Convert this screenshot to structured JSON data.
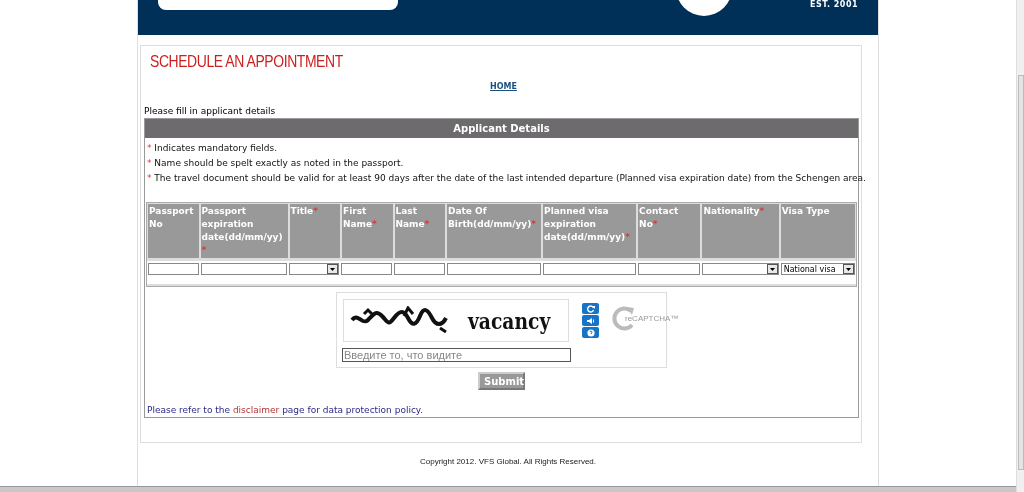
{
  "header": {
    "est": "EST. 2001"
  },
  "title": "SCHEDULE AN APPOINTMENT",
  "home_link": "HOME",
  "intro": "Please fill in applicant details",
  "section": {
    "title": "Applicant Details",
    "notes": [
      {
        "mark": "*",
        "text": "Indicates mandatory fields."
      },
      {
        "mark": "*",
        "text": "Name should be spelt exactly as noted in the passport."
      },
      {
        "mark": "*",
        "text": "The travel document should be valid for at least 90 days after the date of the last intended departure (Planned visa expiration date) from the Schengen area."
      }
    ],
    "columns": [
      {
        "label": "Passport No",
        "kind": "text"
      },
      {
        "label": "Passport expiration date(dd/mm/yy)",
        "required_mark": "*",
        "kind": "text"
      },
      {
        "label": "Title",
        "required_mark": "*",
        "kind": "select"
      },
      {
        "label": "First Name",
        "required_mark": "*",
        "kind": "text"
      },
      {
        "label": "Last Name",
        "required_mark": "*",
        "kind": "text"
      },
      {
        "label": "Date Of Birth(dd/mm/yy)",
        "required_mark": "*",
        "kind": "text"
      },
      {
        "label": "Planned visa expiration date(dd/mm/yy)",
        "required_mark": "*",
        "kind": "text"
      },
      {
        "label": "Contact No",
        "required_mark": "*",
        "kind": "text"
      },
      {
        "label": "Nationality",
        "required_mark": "*",
        "kind": "select"
      },
      {
        "label": "Visa Type",
        "kind": "select",
        "value": "National visa"
      }
    ],
    "captcha": {
      "word": "vacancy",
      "placeholder": "Введите то, что видите",
      "logo": "reCAPTCHA™"
    },
    "submit": "Submit",
    "disclaimer": {
      "before": "Please refer to the",
      "link": "disclaimer",
      "after": "page for data protection policy."
    }
  },
  "footer": "Copyright 2012. VFS Global. All Rights Reserved."
}
